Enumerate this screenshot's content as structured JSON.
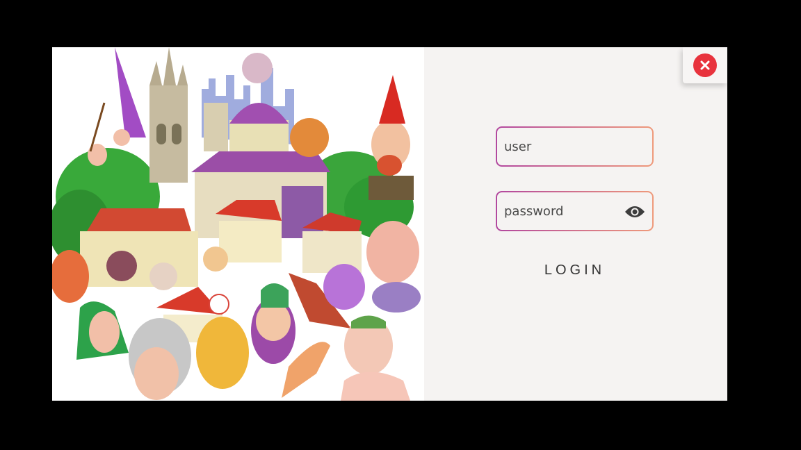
{
  "login_form": {
    "user_placeholder": "user",
    "password_placeholder": "password",
    "login_label": "LOGIN"
  },
  "icons": {
    "close": "close-icon",
    "password_toggle": "eye-icon"
  },
  "colors": {
    "close_button": "#e8333d",
    "field_border_start": "#b2479f",
    "field_border_end": "#ef9a7b",
    "panel_background": "#f5f3f2",
    "backdrop": "#000000"
  }
}
